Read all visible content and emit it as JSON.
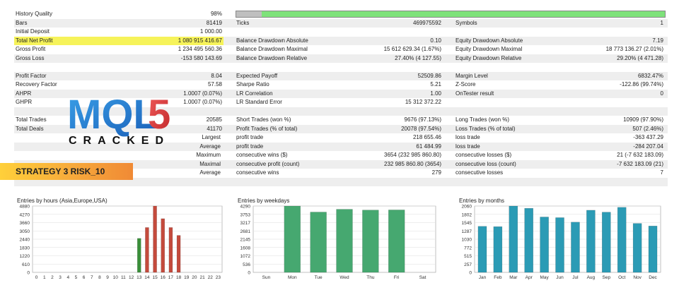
{
  "stats": {
    "rows": [
      [
        "History Quality",
        "98%",
        "",
        "",
        "",
        ""
      ],
      [
        "Bars",
        "81419",
        "Ticks",
        "469975592",
        "Symbols",
        "1"
      ],
      [
        "Initial Deposit",
        "1 000.00",
        "",
        "",
        "",
        ""
      ],
      [
        "Total Net Profit",
        "1 080 915 416.67",
        "Balance Drawdown Absolute",
        "0.10",
        "Equity Drawdown Absolute",
        "7.19"
      ],
      [
        "Gross Profit",
        "1 234 495 560.36",
        "Balance Drawdown Maximal",
        "15 612 629.34 (1.67%)",
        "Equity Drawdown Maximal",
        "18 773 136.27 (2.01%)"
      ],
      [
        "Gross Loss",
        "-153 580 143.69",
        "Balance Drawdown Relative",
        "27.40% (4 127.55)",
        "Equity Drawdown Relative",
        "29.20% (4 471.28)"
      ],
      [
        "",
        "",
        "",
        "",
        "",
        ""
      ],
      [
        "Profit Factor",
        "8.04",
        "Expected Payoff",
        "52509.86",
        "Margin Level",
        "6832.47%"
      ],
      [
        "Recovery Factor",
        "57.58",
        "Sharpe Ratio",
        "5.21",
        "Z-Score",
        "-122.86 (99.74%)"
      ],
      [
        "AHPR",
        "1.0007 (0.07%)",
        "LR Correlation",
        "1.00",
        "OnTester result",
        "0"
      ],
      [
        "GHPR",
        "1.0007 (0.07%)",
        "LR Standard Error",
        "15 312 372.22",
        "",
        ""
      ],
      [
        "",
        "",
        "",
        "",
        "",
        ""
      ],
      [
        "Total Trades",
        "20585",
        "Short Trades (won %)",
        "9676 (97.13%)",
        "Long Trades (won %)",
        "10909 (97.90%)"
      ],
      [
        "Total Deals",
        "41170",
        "Profit Trades (% of total)",
        "20078 (97.54%)",
        "Loss Trades (% of total)",
        "507 (2.46%)"
      ],
      [
        "",
        "Largest",
        "profit trade",
        "218 655.46",
        "loss trade",
        "-363 437.29"
      ],
      [
        "",
        "Average",
        "profit trade",
        "61 484.99",
        "loss trade",
        "-284 207.04"
      ],
      [
        "",
        "Maximum",
        "consecutive wins ($)",
        "3654 (232 985 860.80)",
        "consecutive losses ($)",
        "21 (-7 632 183.09)"
      ],
      [
        "",
        "Maximal",
        "consecutive profit (count)",
        "232 985 860.80 (3654)",
        "consecutive loss (count)",
        "-7 632 183.09 (21)"
      ],
      [
        "",
        "Average",
        "consecutive wins",
        "279",
        "consecutive losses",
        "7"
      ],
      [
        "",
        "",
        "",
        "",
        "",
        ""
      ]
    ]
  },
  "history_quality_fraction": 0.94,
  "logo": {
    "main": "MQL5",
    "sub": "CRACKED"
  },
  "banner": "STRATEGY 3 RISK_10",
  "colors": {
    "hours_bar": "#c44a3c",
    "hours_bar_green": "#3a8f3a",
    "weekday_bar": "#46a870",
    "month_bar": "#2b9bb5",
    "highlight": "#f6f35a"
  },
  "chart_data": [
    {
      "type": "bar",
      "title": "Entries by hours (Asia,Europe,USA)",
      "categories": [
        "0",
        "1",
        "2",
        "3",
        "4",
        "5",
        "6",
        "7",
        "8",
        "9",
        "10",
        "11",
        "12",
        "13",
        "14",
        "15",
        "16",
        "17",
        "18",
        "19",
        "20",
        "21",
        "22",
        "23"
      ],
      "values": [
        0,
        0,
        0,
        0,
        0,
        0,
        0,
        0,
        0,
        0,
        0,
        0,
        0,
        2500,
        3300,
        4880,
        3950,
        3300,
        2720,
        0,
        0,
        0,
        0,
        0
      ],
      "yticks": [
        "0",
        "610",
        "1220",
        "1830",
        "2440",
        "3050",
        "3660",
        "4270",
        "4880"
      ],
      "ylim": [
        0,
        4880
      ]
    },
    {
      "type": "bar",
      "title": "Entries by weekdays",
      "categories": [
        "Sun",
        "Mon",
        "Tue",
        "Wed",
        "Thu",
        "Fri",
        "Sat"
      ],
      "values": [
        0,
        4290,
        3900,
        4080,
        4030,
        4040,
        0
      ],
      "yticks": [
        "0",
        "536",
        "1072",
        "1608",
        "2145",
        "2681",
        "3217",
        "3753",
        "4290"
      ],
      "ylim": [
        0,
        4290
      ]
    },
    {
      "type": "bar",
      "title": "Entries by months",
      "categories": [
        "Jan",
        "Feb",
        "Mar",
        "Apr",
        "May",
        "Jun",
        "Jul",
        "Aug",
        "Sep",
        "Oct",
        "Nov",
        "Dec"
      ],
      "values": [
        1430,
        1420,
        2060,
        1990,
        1720,
        1700,
        1560,
        1930,
        1870,
        2020,
        1520,
        1440
      ],
      "yticks": [
        "0",
        "257",
        "515",
        "772",
        "1030",
        "1287",
        "1545",
        "1802",
        "2060"
      ],
      "ylim": [
        0,
        2060
      ]
    }
  ]
}
